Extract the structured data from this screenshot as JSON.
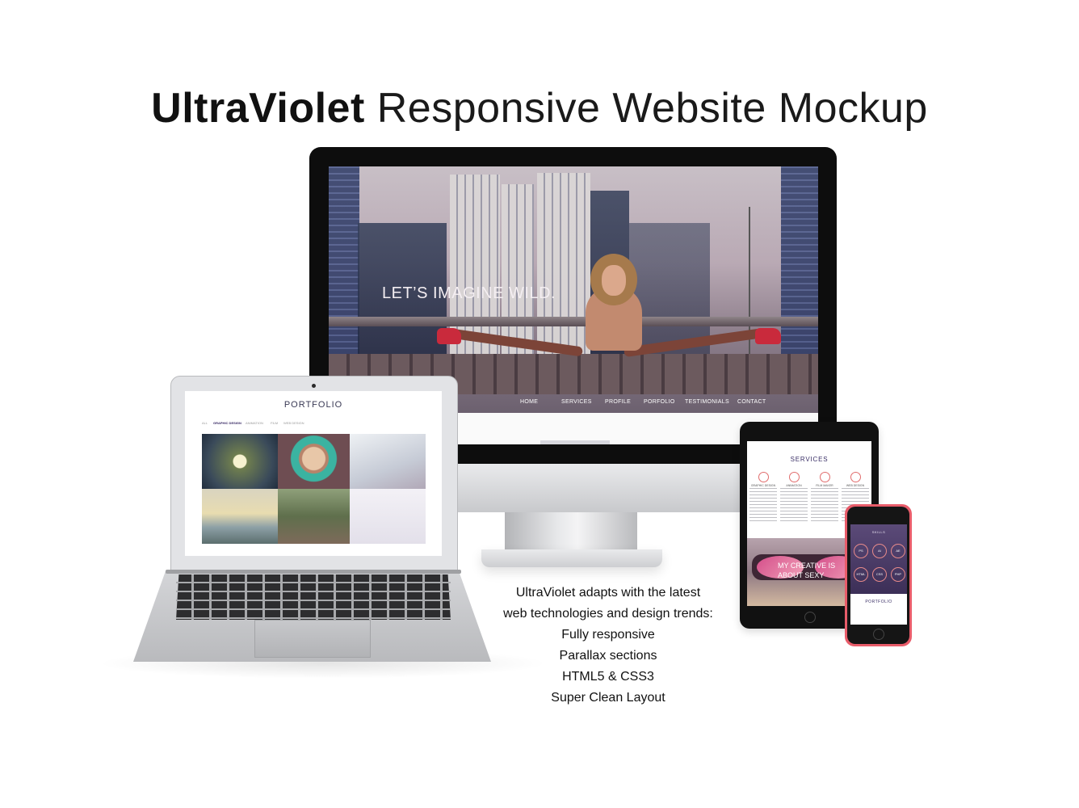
{
  "title": {
    "bold": "UltraViolet",
    "light": "Responsive Website Mockup"
  },
  "imac": {
    "hero_text": "LET’S IMAGINE WILD.",
    "nav": [
      "HOME",
      "SERVICES",
      "PROFILE",
      "PORFOLIO",
      "TESTIMONIALS",
      "CONTACT"
    ]
  },
  "laptop": {
    "title": "PORTFOLIO",
    "filters": [
      "ALL",
      "GRAPHIC DESIGN",
      "ANIMATION",
      "FILM",
      "WEB DESIGN"
    ]
  },
  "tablet": {
    "title": "SERVICES",
    "services": [
      "GRAPHIC DESIGN",
      "ANIMATION",
      "FILM MAKER",
      "WEB DESIGN"
    ],
    "quote": "MY CREATIVE IS ABOUT SEXY"
  },
  "phone": {
    "skills_title": "SKILLS",
    "skills": [
      "PS",
      "AI",
      "AE",
      "HTML",
      "CSS",
      "PHP"
    ],
    "portfolio_title": "PORTFOLIO"
  },
  "features": {
    "lines": [
      "UltraViolet adapts with the latest",
      "web technologies and design trends:",
      "Fully responsive",
      "Parallax sections",
      "HTML5 & CSS3",
      "Super Clean Layout"
    ]
  }
}
